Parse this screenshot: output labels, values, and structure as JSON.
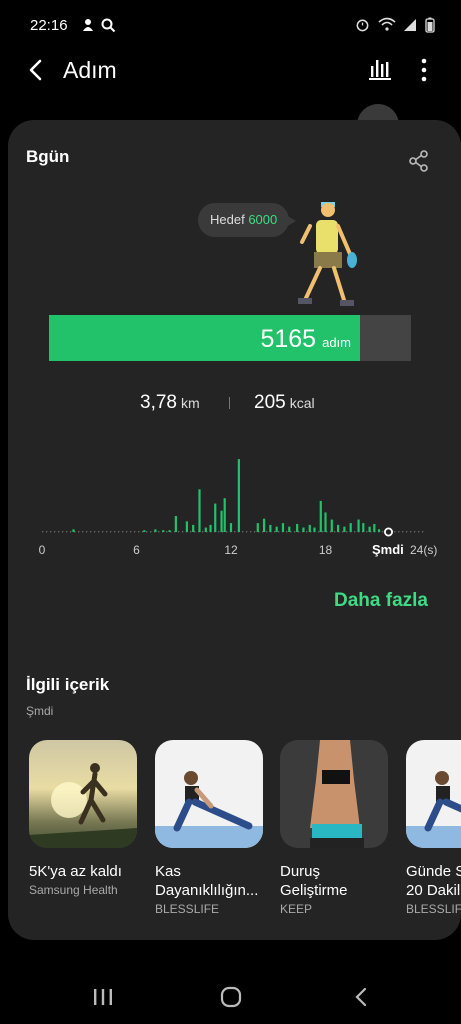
{
  "status_bar": {
    "time": "22:16",
    "left_icons": [
      "notification-icon",
      "search-icon"
    ],
    "right_icons": [
      "alarm-icon",
      "wifi-icon",
      "signal-icon",
      "battery-icon"
    ]
  },
  "app_bar": {
    "title": "Adım",
    "icons": [
      "back-icon",
      "bar-chart-icon",
      "more-vert-icon"
    ]
  },
  "today_card": {
    "title": "Bgün",
    "goal_label": "Hedef",
    "goal_value": "6000",
    "steps": "5165",
    "steps_unit": "adım",
    "progress": 0.86,
    "distance": "3,78",
    "distance_unit": "km",
    "calories": "205",
    "calories_unit": "kcal",
    "accent_color": "#21c26a"
  },
  "chart_data": {
    "type": "bar",
    "x_tick_labels": [
      "0",
      "6",
      "12",
      "18"
    ],
    "now_label": "Şmdi",
    "end_label": "24(s)",
    "x": [
      2,
      6.5,
      7.2,
      7.7,
      8.1,
      8.5,
      9.2,
      9.6,
      10.0,
      10.4,
      10.7,
      11.0,
      11.4,
      11.6,
      12.0,
      12.5,
      13.7,
      14.1,
      14.5,
      14.9,
      15.3,
      15.7,
      16.2,
      16.6,
      17.0,
      17.3,
      17.7,
      18.0,
      18.4,
      18.8,
      19.2,
      19.6,
      20.1,
      20.4,
      20.8,
      21.1,
      21.4
    ],
    "values": [
      3,
      2,
      3,
      2,
      2,
      18,
      12,
      8,
      48,
      5,
      8,
      32,
      24,
      38,
      10,
      82,
      10,
      15,
      8,
      6,
      10,
      6,
      9,
      5,
      8,
      5,
      35,
      22,
      14,
      8,
      6,
      10,
      14,
      10,
      6,
      9,
      3
    ],
    "ylim": [
      0,
      90
    ],
    "now_position": 22
  },
  "more_link": "Daha fazla",
  "related": {
    "title": "İlgili içerik",
    "subtitle": "Şmdi",
    "items": [
      {
        "title": "5K'ya az kaldı",
        "source": "Samsung Health"
      },
      {
        "title": "Kas\nDayanıklılığın...",
        "source": "BLESSLIFE"
      },
      {
        "title": "Duruş\nGeliştirme",
        "source": "KEEP"
      },
      {
        "title": "Günde S\n20 Dakil",
        "source": "BLESSLIF"
      }
    ]
  },
  "nav_bar": {
    "icons": [
      "recent-apps-icon",
      "home-icon",
      "back-nav-icon"
    ]
  }
}
